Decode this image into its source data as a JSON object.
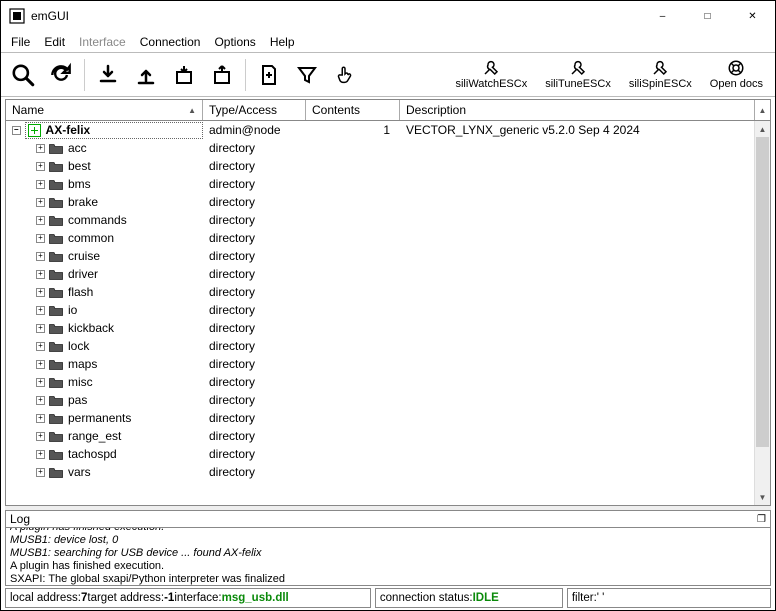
{
  "window": {
    "title": "emGUI"
  },
  "menu": {
    "file": "File",
    "edit": "Edit",
    "interface": "Interface",
    "connection": "Connection",
    "options": "Options",
    "help": "Help"
  },
  "toolbar": {
    "siliwatch": "siliWatchESCx",
    "silitune": "siliTuneESCx",
    "silispin": "siliSpinESCx",
    "opendocs": "Open docs"
  },
  "columns": {
    "name": "Name",
    "type": "Type/Access",
    "contents": "Contents",
    "description": "Description"
  },
  "root": {
    "name": "AX-felix",
    "type": "admin@node",
    "contents": "1",
    "description": "VECTOR_LYNX_generic v5.2.0 Sep  4 2024"
  },
  "items": [
    {
      "name": "acc",
      "type": "directory",
      "exp": "+"
    },
    {
      "name": "best",
      "type": "directory",
      "exp": "+"
    },
    {
      "name": "bms",
      "type": "directory",
      "exp": "+"
    },
    {
      "name": "brake",
      "type": "directory",
      "exp": "+"
    },
    {
      "name": "commands",
      "type": "directory",
      "exp": "+"
    },
    {
      "name": "common",
      "type": "directory",
      "exp": "+"
    },
    {
      "name": "cruise",
      "type": "directory",
      "exp": "+"
    },
    {
      "name": "driver",
      "type": "directory",
      "exp": "+"
    },
    {
      "name": "flash",
      "type": "directory",
      "exp": "+"
    },
    {
      "name": "io",
      "type": "directory",
      "exp": "+"
    },
    {
      "name": "kickback",
      "type": "directory",
      "exp": "+"
    },
    {
      "name": "lock",
      "type": "directory",
      "exp": "+"
    },
    {
      "name": "maps",
      "type": "directory",
      "exp": "+"
    },
    {
      "name": "misc",
      "type": "directory",
      "exp": "+"
    },
    {
      "name": "pas",
      "type": "directory",
      "exp": "+"
    },
    {
      "name": "permanents",
      "type": "directory",
      "exp": "+"
    },
    {
      "name": "range_est",
      "type": "directory",
      "exp": "+"
    },
    {
      "name": "tachospd",
      "type": "directory",
      "exp": "+"
    },
    {
      "name": "vars",
      "type": "directory",
      "exp": "+"
    }
  ],
  "log": {
    "title": "Log",
    "lines": [
      {
        "text": "MUSB1: device lost, 0",
        "style": "italic"
      },
      {
        "text": "MUSB1: searching for USB device ... found AX-felix",
        "style": "italic"
      },
      {
        "text": "A plugin has finished execution.",
        "style": ""
      },
      {
        "text": "SXAPI: The global sxapi/Python interpreter was finalized",
        "style": ""
      }
    ]
  },
  "status": {
    "local_label": "local address: ",
    "local_val": "7",
    "target_label": " target address: ",
    "target_val": "-1",
    "iface_label": " interface: ",
    "iface_val": "msg_usb.dll",
    "conn_label": "connection status: ",
    "conn_val": "IDLE",
    "filter_label": "filter: ",
    "filter_val": "' '"
  }
}
